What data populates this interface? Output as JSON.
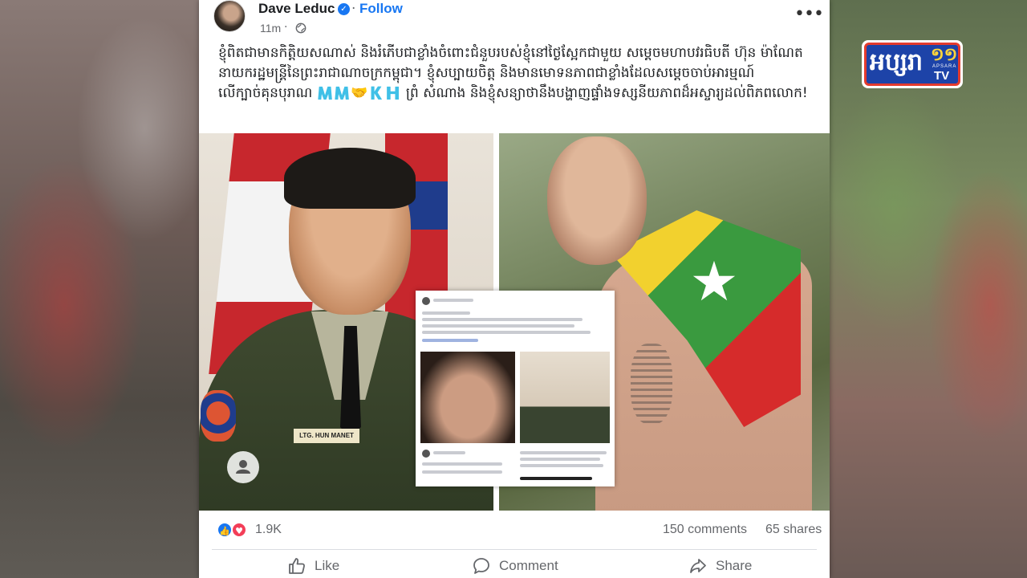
{
  "post": {
    "author": "Dave Leduc",
    "follow_label": "Follow",
    "separator": "·",
    "timestamp": "11m",
    "caption": "ខ្ញុំពិតជាមានកិត្តិយសណាស់ និងរំភើបជាខ្លាំងចំពោះជំនួបរបស់ខ្ញុំនៅថ្ងៃស្អែកជាមួយ សម្តេចមហាបវរធិបតី ហ៊ុន ម៉ាណែត នាយករដ្ឋមន្ត្រីនៃព្រះរាជាណាចក្រកម្ពុជា។ ខ្ញុំសប្បាយចិត្ត និងមានមោទនភាពជាខ្លាំងដែលសម្តេចចាប់អារម្មណ៍លើក្បាច់គុនបុរាណ 🇲🇲🤝🇰🇭 ព្រំ សំណាង និងខ្ញុំសន្យាថានឹងបង្ហាញផ្ទាំងទស្សនីយភាពដ៏អស្ចារ្យដល់ពិភពលោក!",
    "photo_nameplate": "LTG. HUN MANET"
  },
  "stats": {
    "reaction_count": "1.9K",
    "comments": "150 comments",
    "shares": "65 shares"
  },
  "actions": {
    "like": "Like",
    "comment": "Comment",
    "share": "Share"
  },
  "logo": {
    "text": "អប្សរា",
    "number": "១១",
    "brand": "APSARA",
    "tv": "TV"
  },
  "icons": [
    "verified-badge-icon",
    "globe-icon",
    "more-options-icon",
    "profile-icon",
    "like-reaction-icon",
    "love-reaction-icon",
    "like-icon",
    "comment-icon",
    "share-icon"
  ],
  "colors": {
    "accent": "#1877f2",
    "love": "#f33e58",
    "text_secondary": "#65676b",
    "logo_blue": "#1d43a8",
    "logo_red": "#e33b2e"
  }
}
